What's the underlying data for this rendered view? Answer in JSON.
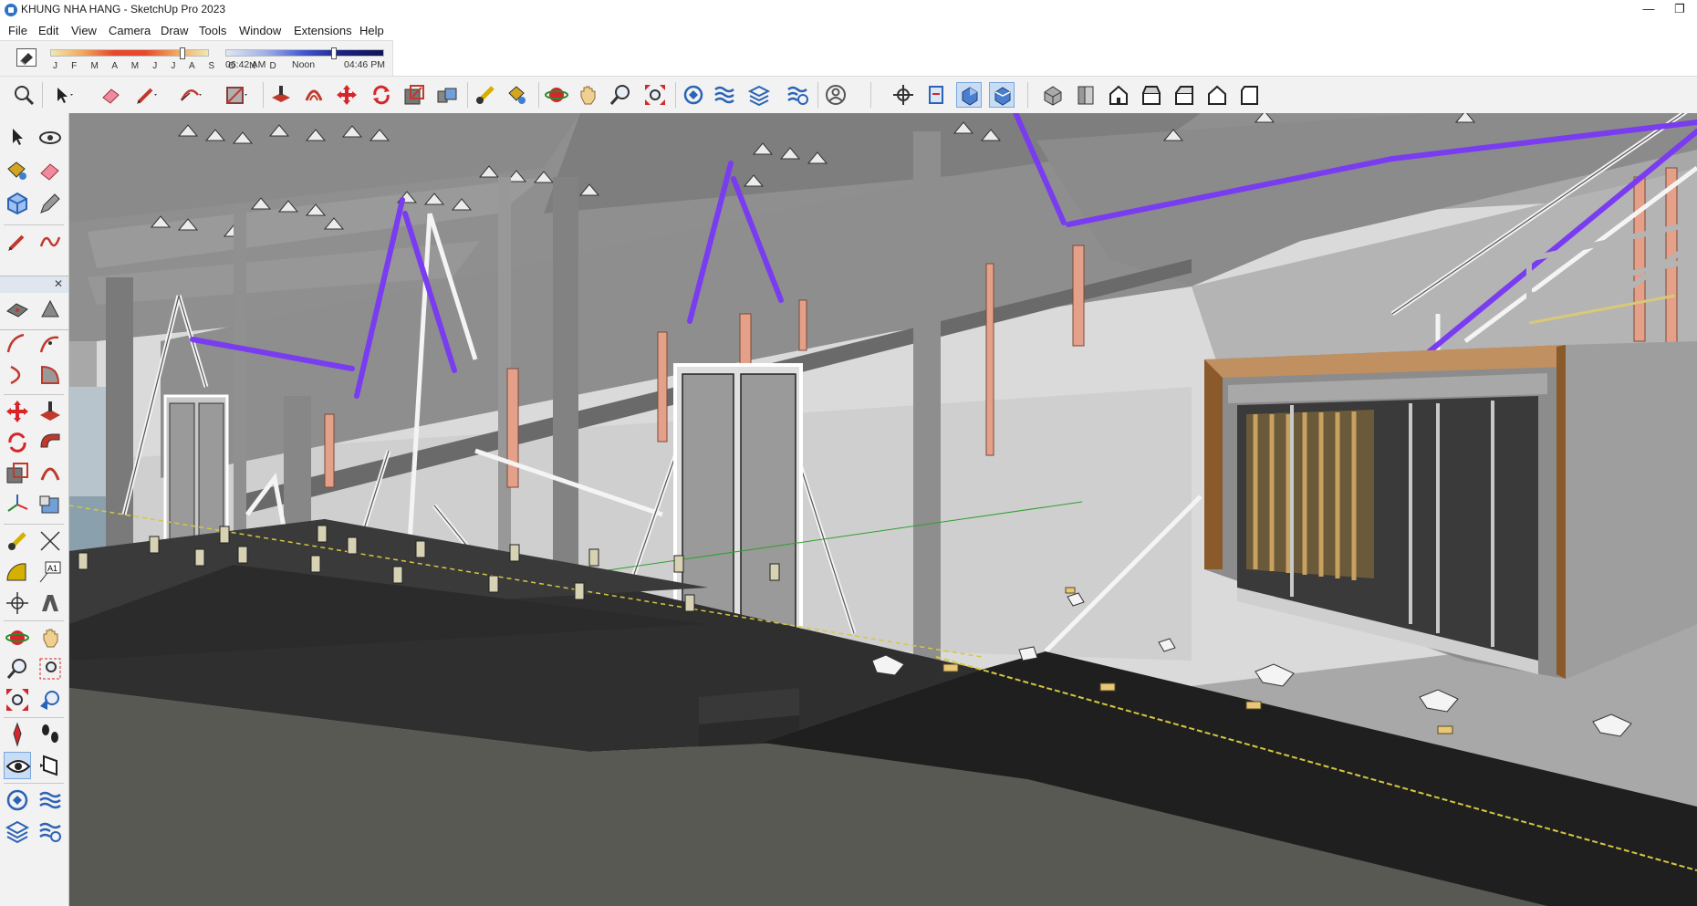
{
  "window": {
    "title": "KHUNG NHA HANG - SketchUp Pro 2023",
    "controls": {
      "minimize": "—",
      "restore": "❐"
    }
  },
  "menu": [
    "File",
    "Edit",
    "View",
    "Camera",
    "Draw",
    "Tools",
    "Window",
    "Extensions",
    "Help"
  ],
  "shadows": {
    "months": "J F M A M J J A S O N D",
    "month_level": 0.83,
    "time_start": "06:42 AM",
    "time_noon": "Noon",
    "time_end": "04:46 PM",
    "time_level": 0.68
  },
  "toolbar_icons": [
    "search-icon",
    "select-arrow-icon",
    "eraser-icon",
    "pencil-icon",
    "arc-icon",
    "rectangle-icon",
    "push-pull-icon",
    "offset-icon",
    "move-icon",
    "rotate-icon",
    "scale-icon",
    "follow-me-icon",
    "tape-measure-icon",
    "paint-bucket-icon",
    "orbit-icon",
    "pan-icon",
    "zoom-icon",
    "zoom-extents-icon",
    "warehouse-icon",
    "extension-warehouse-icon",
    "layout-icon",
    "extension-manager-icon",
    "account-icon",
    "position-camera-icon",
    "section-plane-icon",
    "section-cut-icon",
    "section-fill-icon",
    "iso-view-icon",
    "top-view-icon",
    "front-view-icon",
    "right-view-icon",
    "back-view-icon",
    "left-view-icon",
    "bottom-view-icon"
  ],
  "left_tools": [
    "select-icon",
    "orbit-icon",
    "paint-icon",
    "eraser-icon",
    "component-icon",
    "tag-icon",
    "pencil-icon",
    "freehand-icon",
    "rectangle-icon",
    "rotated-rectangle-icon",
    "arc-icon",
    "pie-icon",
    "move-icon",
    "push-pull-icon",
    "rotate-icon",
    "follow-me-icon",
    "scale-icon",
    "offset-icon",
    "tape-measure-icon",
    "dimension-icon",
    "protractor-icon",
    "text-icon",
    "axes-icon",
    "3d-text-icon",
    "orbit-icon",
    "pan-icon",
    "zoom-icon",
    "zoom-window-icon",
    "zoom-extents-icon",
    "previous-view-icon",
    "position-camera-icon",
    "walk-icon",
    "look-around-icon",
    "section-plane-icon",
    "warehouse-icon",
    "extension-warehouse-icon",
    "layout-icon",
    "extension-manager-icon"
  ],
  "colors": {
    "purple_beam": "#7a3cf0",
    "frame_brown": "#8a5a2a",
    "floor": "#2a2a2a",
    "wood": "#c8a060"
  }
}
